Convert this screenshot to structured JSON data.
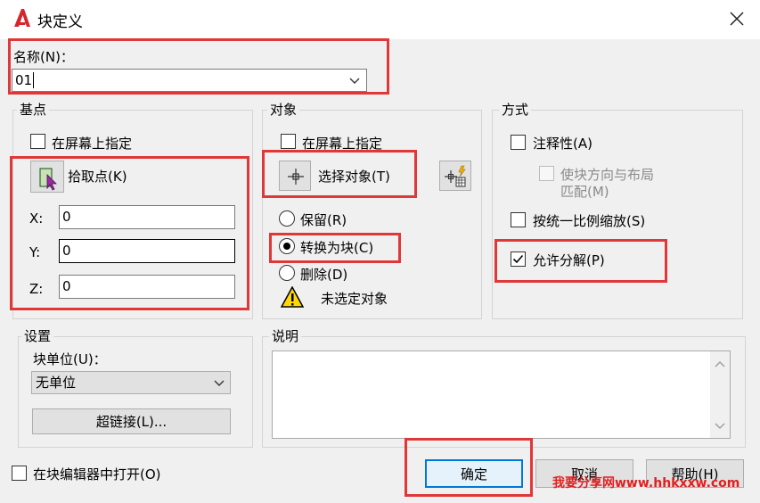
{
  "title": "块定义",
  "name": {
    "label": "名称(N)：",
    "value": "01"
  },
  "basepoint": {
    "title": "基点",
    "onscreen_label": "在屏幕上指定",
    "pick_label": "拾取点(K)",
    "x_label": "X:",
    "x_value": "0",
    "y_label": "Y:",
    "y_value": "0",
    "z_label": "Z:",
    "z_value": "0"
  },
  "objects": {
    "title": "对象",
    "onscreen_label": "在屏幕上指定",
    "select_label": "选择对象(T)",
    "retain_label": "保留(R)",
    "convert_label": "转换为块(C)",
    "delete_label": "删除(D)",
    "warning_text": "未选定对象"
  },
  "behavior": {
    "title": "方式",
    "annotative_label": "注释性(A)",
    "match_orient_line1": "使块方向与布局",
    "match_orient_line2": "匹配(M)",
    "uniform_scale_label": "按统一比例缩放(S)",
    "allow_explode_label": "允许分解(P)"
  },
  "settings": {
    "title": "设置",
    "unit_label": "块单位(U)：",
    "unit_value": "无单位",
    "hyperlink_label": "超链接(L)..."
  },
  "description": {
    "title": "说明",
    "value": ""
  },
  "open_in_editor_label": "在块编辑器中打开(O)",
  "buttons": {
    "ok": "确定",
    "cancel": "取消",
    "help": "帮助(H)"
  },
  "watermark": "我要分享网www.hhkxxw.com"
}
